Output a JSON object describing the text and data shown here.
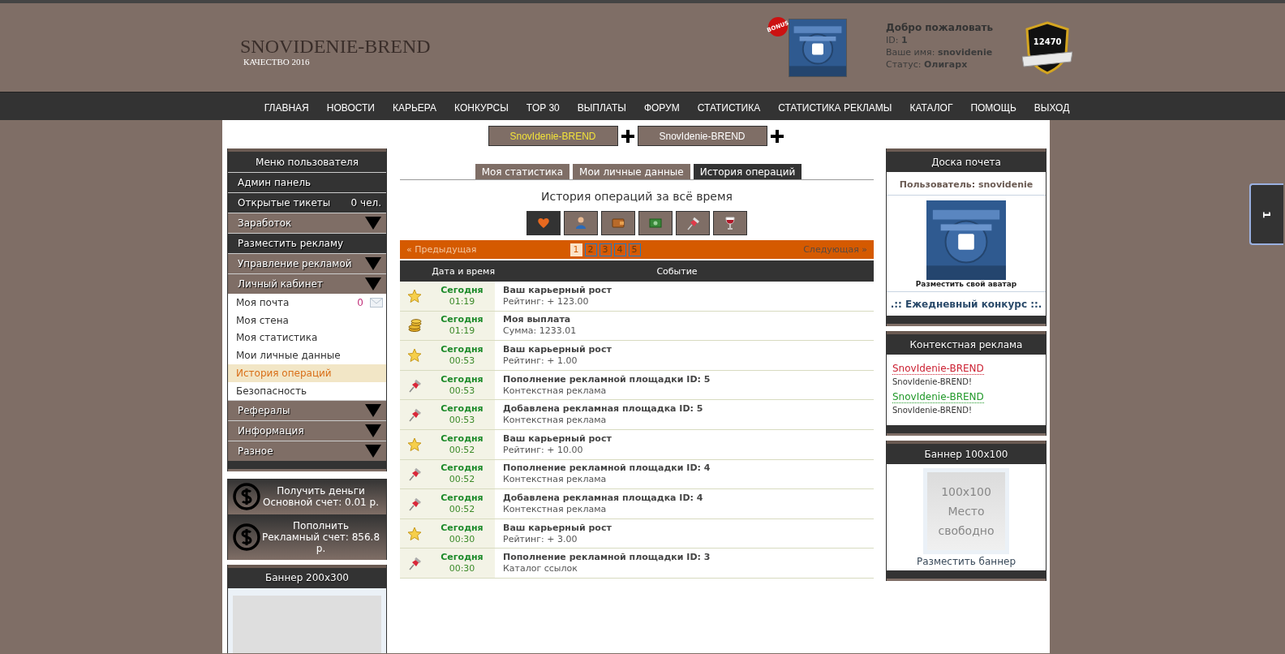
{
  "header": {
    "logo_title": "SNOVIDENIE-BREND",
    "logo_subtitle": "КАЧЕСТВО 2016",
    "bonus_badge": "BONUS",
    "welcome": {
      "title": "Добро пожаловать",
      "id_label": "ID:",
      "id": "1",
      "name_label": "Ваше имя:",
      "name": "snovidenie",
      "status_label": "Статус:",
      "status": "Олигарх"
    },
    "rating": "12470"
  },
  "nav": [
    "ГЛАВНАЯ",
    "НОВОСТИ",
    "КАРЬЕРА",
    "КОНКУРСЫ",
    "TOP 30",
    "ВЫПЛАТЫ",
    "ФОРУМ",
    "СТАТИСТИКА",
    "СТАТИСТИКА РЕКЛАМЫ",
    "КАТАЛОГ",
    "ПОМОЩЬ",
    "ВЫХОД"
  ],
  "promo_buttons": [
    {
      "label": "SnovIdenie-BREND",
      "highlighted": true
    },
    {
      "label": "SnovIdenie-BREND",
      "highlighted": false
    }
  ],
  "left_menu": {
    "title": "Меню пользователя",
    "items": [
      {
        "kind": "dark",
        "label": "Админ панель"
      },
      {
        "kind": "dark",
        "label": "Открытые тикеты",
        "count": "0 чел."
      },
      {
        "kind": "section",
        "label": "Заработок"
      },
      {
        "kind": "dark",
        "label": "Разместить рекламу"
      },
      {
        "kind": "section",
        "label": "Управление рекламой"
      },
      {
        "kind": "section",
        "label": "Личный кабинет",
        "children": [
          {
            "label": "Моя почта",
            "count": "0",
            "mail": true,
            "selected": false
          },
          {
            "label": "Моя стена",
            "selected": false
          },
          {
            "label": "Моя статистика",
            "selected": false
          },
          {
            "label": "Мои личные данные",
            "selected": false
          },
          {
            "label": "История операций",
            "selected": true
          },
          {
            "label": "Безопасность",
            "selected": false
          }
        ]
      },
      {
        "kind": "section",
        "label": "Рефералы"
      },
      {
        "kind": "section",
        "label": "Информация"
      },
      {
        "kind": "section",
        "label": "Разное"
      }
    ]
  },
  "money_boxes": [
    {
      "title": "Получить деньги",
      "subtitle": "Основной счет: 0.01 р."
    },
    {
      "title": "Пополнить",
      "subtitle": "Рекламный счет: 856.8 р."
    }
  ],
  "banner_left": {
    "title": "Баннер 200x300"
  },
  "tabs": [
    {
      "label": "Моя статистика",
      "selected": false
    },
    {
      "label": "Мои личные данные",
      "selected": false
    },
    {
      "label": "История операций",
      "selected": true
    }
  ],
  "heading": "История операций за всё время",
  "filters": [
    {
      "kind": "heart",
      "selected": true
    },
    {
      "kind": "person",
      "selected": false
    },
    {
      "kind": "wallet",
      "selected": false
    },
    {
      "kind": "money",
      "selected": false
    },
    {
      "kind": "pin",
      "selected": false
    },
    {
      "kind": "wine",
      "selected": false
    }
  ],
  "pagination": {
    "prev": "« Предыдущая",
    "next": "Следующая »",
    "pages": [
      {
        "label": "1",
        "selected": true
      },
      {
        "label": "2",
        "selected": false
      },
      {
        "label": "3",
        "selected": false
      },
      {
        "label": "4",
        "selected": false
      },
      {
        "label": "5",
        "selected": false
      }
    ]
  },
  "table": {
    "columns": [
      "Дата и время",
      "Событие"
    ],
    "rows": [
      {
        "kind": "star",
        "day": "Сегодня",
        "time": "01:19",
        "title": "Ваш карьерный рост",
        "detail": "Рейтинг: + 123.00"
      },
      {
        "kind": "coins",
        "day": "Сегодня",
        "time": "01:19",
        "title": "Моя выплата",
        "detail": "Сумма: 1233.01"
      },
      {
        "kind": "star",
        "day": "Сегодня",
        "time": "00:53",
        "title": "Ваш карьерный рост",
        "detail": "Рейтинг: + 1.00"
      },
      {
        "kind": "pin",
        "day": "Сегодня",
        "time": "00:53",
        "title": "Пополнение рекламной площадки ID: 5",
        "detail": "Контекстная реклама"
      },
      {
        "kind": "pin",
        "day": "Сегодня",
        "time": "00:53",
        "title": "Добавлена рекламная площадка ID: 5",
        "detail": "Контекстная реклама"
      },
      {
        "kind": "star",
        "day": "Сегодня",
        "time": "00:52",
        "title": "Ваш карьерный рост",
        "detail": "Рейтинг: + 10.00"
      },
      {
        "kind": "pin",
        "day": "Сегодня",
        "time": "00:52",
        "title": "Пополнение рекламной площадки ID: 4",
        "detail": "Контекстная реклама"
      },
      {
        "kind": "pin",
        "day": "Сегодня",
        "time": "00:52",
        "title": "Добавлена рекламная площадка ID: 4",
        "detail": "Контекстная реклама"
      },
      {
        "kind": "star",
        "day": "Сегодня",
        "time": "00:30",
        "title": "Ваш карьерный рост",
        "detail": "Рейтинг: + 3.00"
      },
      {
        "kind": "pin",
        "day": "Сегодня",
        "time": "00:30",
        "title": "Пополнение рекламной площадки ID: 3",
        "detail": "Каталог ссылок"
      }
    ]
  },
  "honor_board": {
    "title": "Доска почета",
    "user": "Пользователь: snovidenie",
    "avatar_caption": "Разместить свой аватар",
    "contest_link": ".:: Ежедневный конкурс ::."
  },
  "context_ads": {
    "title": "Контекстная реклама",
    "ads": [
      {
        "link": "SnovIdenie-BREND",
        "text": "SnovIdenie-BREND!",
        "color": "#cc2233"
      },
      {
        "link": "SnovIdenie-BREND",
        "text": "SnovIdenie-BREND!",
        "color": "#22992a"
      }
    ]
  },
  "banner_right": {
    "title": "Баннер 100x100",
    "placeholder": "100x100\nМесто\nсвободно",
    "caption": "Разместить баннер"
  },
  "side_tab": "1"
}
